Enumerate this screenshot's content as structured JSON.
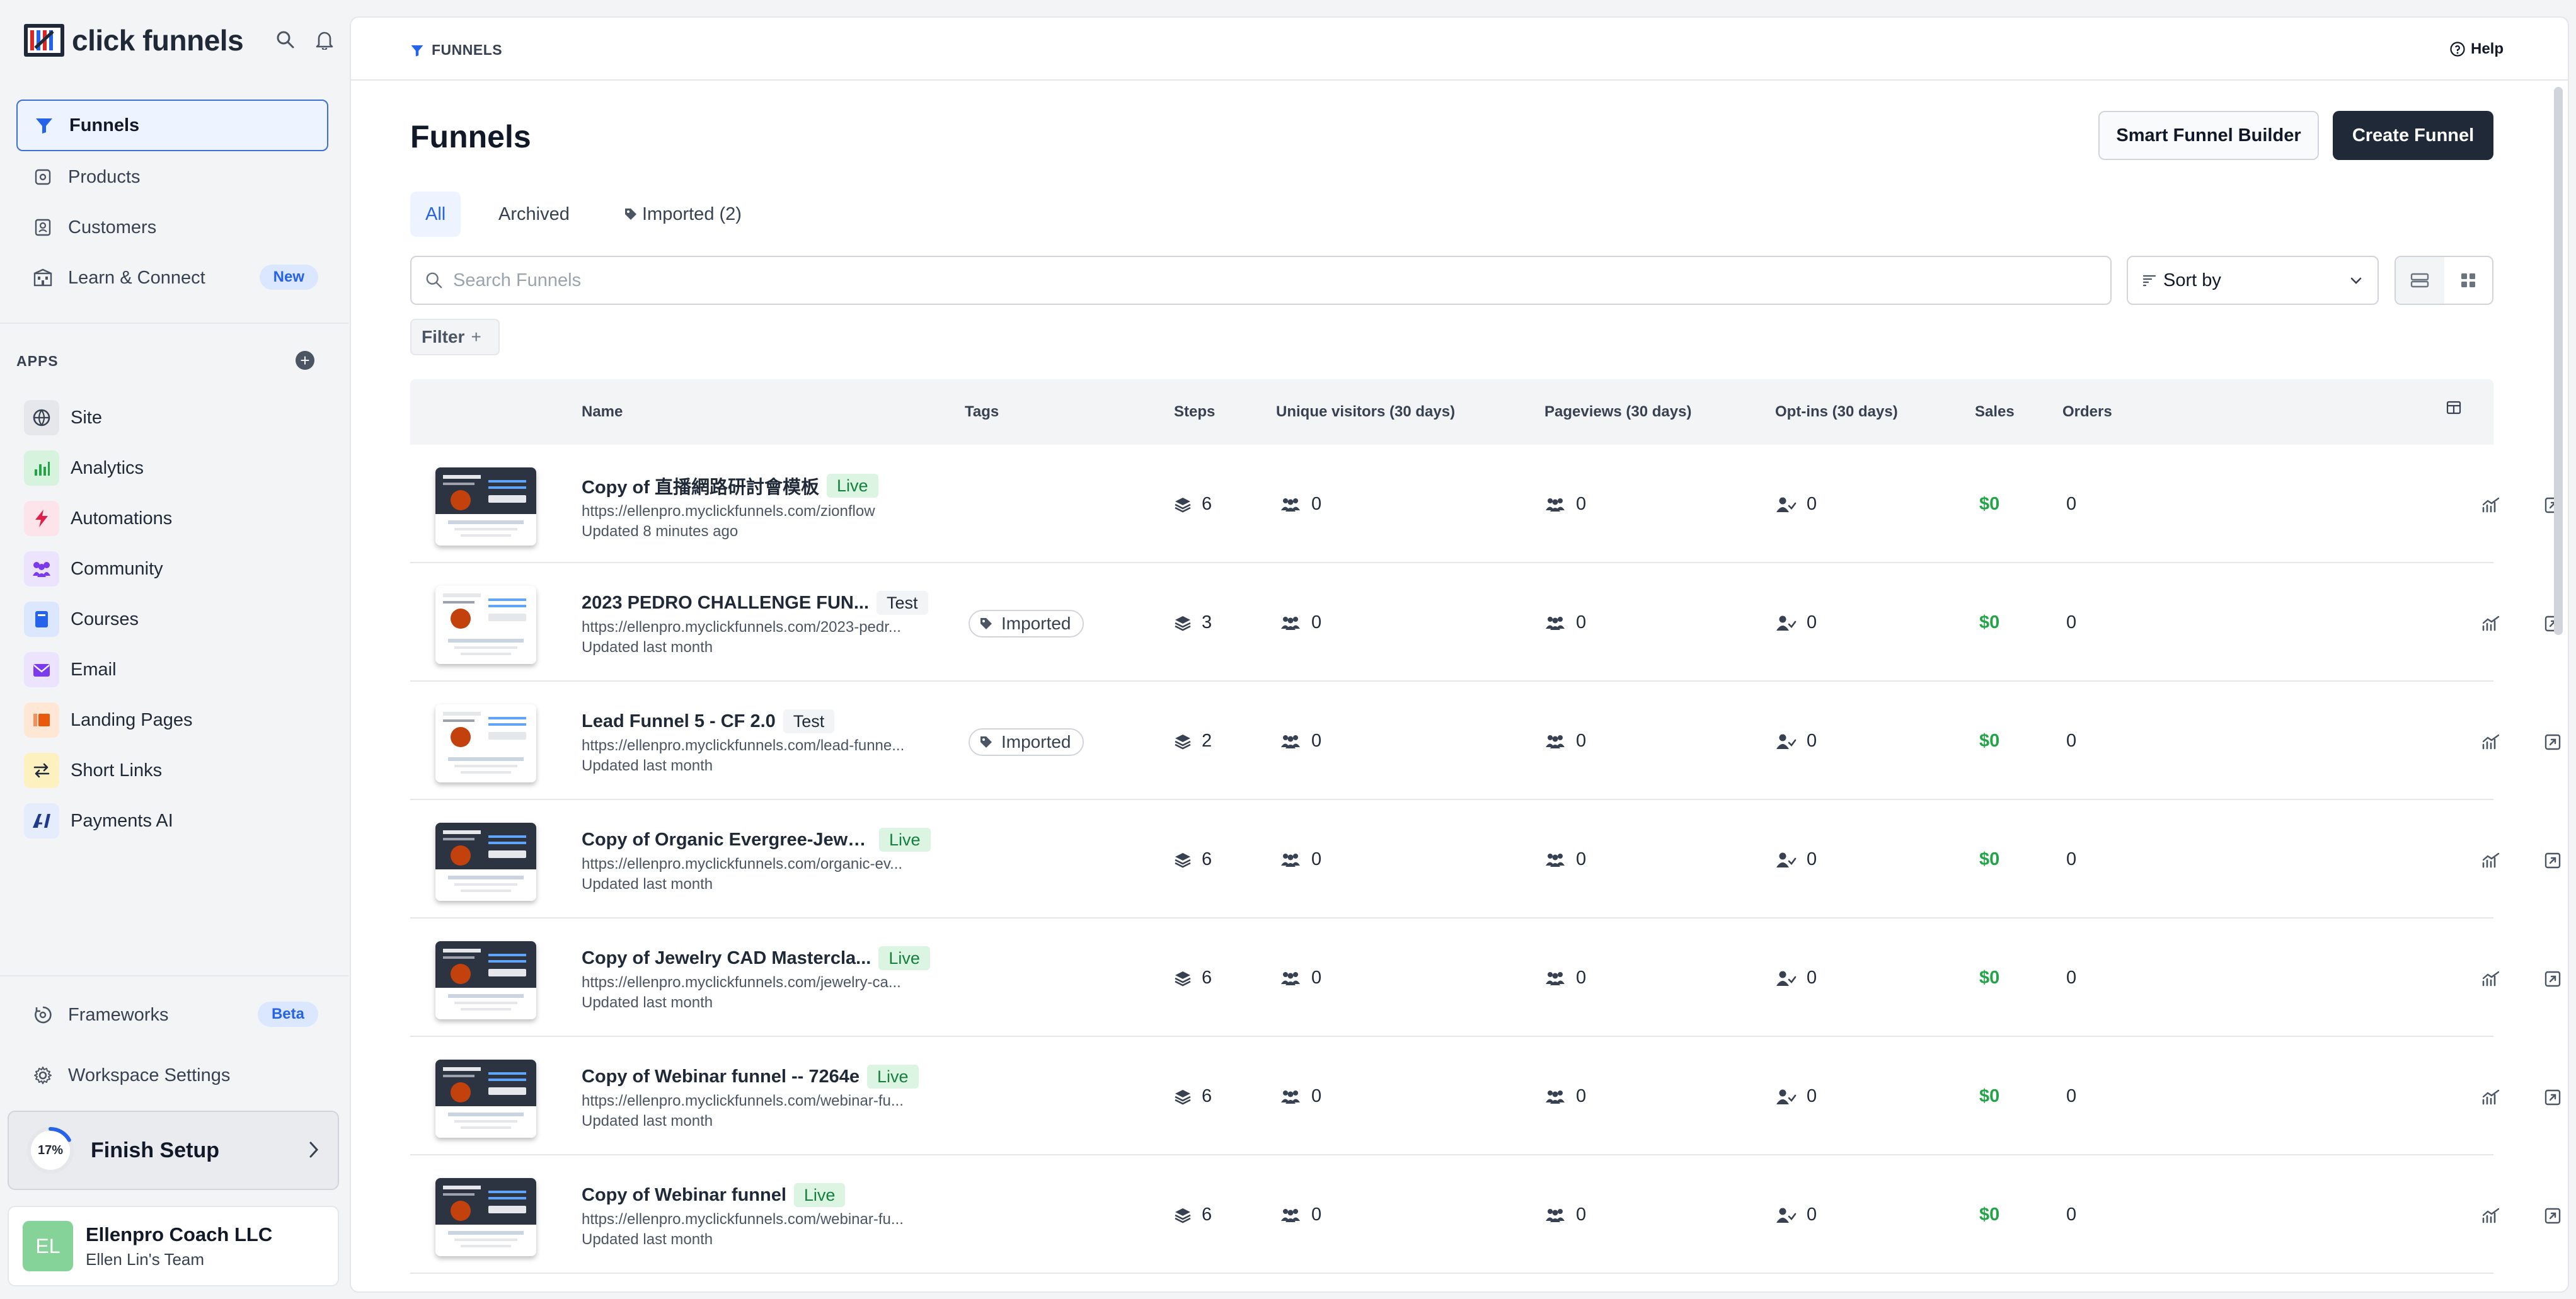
{
  "brand": {
    "name": "click funnels"
  },
  "sidebar": {
    "nav": [
      {
        "label": "Funnels",
        "icon": "funnel-icon",
        "active": true
      },
      {
        "label": "Products",
        "icon": "box-icon"
      },
      {
        "label": "Customers",
        "icon": "contact-icon"
      },
      {
        "label": "Learn & Connect",
        "icon": "building-icon",
        "badge": "New"
      }
    ],
    "apps_label": "APPS",
    "apps": [
      {
        "label": "Site",
        "icon": "globe-icon",
        "color": "#6b7280"
      },
      {
        "label": "Analytics",
        "icon": "bar-chart-icon",
        "color": "#22a447"
      },
      {
        "label": "Automations",
        "icon": "bolt-icon",
        "color": "#e11d48"
      },
      {
        "label": "Community",
        "icon": "people-icon",
        "color": "#7c3aed"
      },
      {
        "label": "Courses",
        "icon": "book-icon",
        "color": "#2563eb"
      },
      {
        "label": "Email",
        "icon": "mail-icon",
        "color": "#7c3aed"
      },
      {
        "label": "Landing Pages",
        "icon": "pages-icon",
        "color": "#ea580c"
      },
      {
        "label": "Short Links",
        "icon": "swap-icon",
        "color": "#ca8a04"
      },
      {
        "label": "Payments AI",
        "icon": "ai-icon",
        "color": "#1e3a8a"
      }
    ],
    "frameworks": {
      "label": "Frameworks",
      "badge": "Beta"
    },
    "workspace_settings": "Workspace Settings",
    "finish_setup": {
      "label": "Finish Setup",
      "progress_text": "17%",
      "progress": 0.17
    },
    "account": {
      "initials": "EL",
      "name": "Ellenpro Coach LLC",
      "team": "Ellen Lin's Team"
    }
  },
  "header": {
    "breadcrumb": "FUNNELS",
    "help": "Help"
  },
  "main": {
    "title": "Funnels",
    "smart_builder": "Smart Funnel Builder",
    "create": "Create Funnel",
    "tabs": [
      {
        "label": "All",
        "active": true
      },
      {
        "label": "Archived"
      },
      {
        "label": "Imported (2)",
        "icon": "tag-icon"
      }
    ],
    "search_placeholder": "Search Funnels",
    "sort_label": "Sort by",
    "filter_label": "Filter",
    "filter_plus": "+"
  },
  "table": {
    "columns": [
      "Name",
      "Tags",
      "Steps",
      "Unique visitors (30 days)",
      "Pageviews (30 days)",
      "Opt-ins (30 days)",
      "Sales",
      "Orders"
    ],
    "rows": [
      {
        "name": "Copy of 直播網路研討會模板",
        "status": "Live",
        "url": "https://ellenpro.myclickfunnels.com/zionflow",
        "updated": "Updated 8 minutes ago",
        "tag": "",
        "steps": "6",
        "visitors": "0",
        "pageviews": "0",
        "optins": "0",
        "sales": "$0",
        "orders": "0"
      },
      {
        "name": "2023 PEDRO CHALLENGE FUN...",
        "status": "Test",
        "url": "https://ellenpro.myclickfunnels.com/2023-pedr...",
        "updated": "Updated last month",
        "tag": "Imported",
        "steps": "3",
        "visitors": "0",
        "pageviews": "0",
        "optins": "0",
        "sales": "$0",
        "orders": "0"
      },
      {
        "name": "Lead Funnel 5 - CF 2.0",
        "status": "Test",
        "url": "https://ellenpro.myclickfunnels.com/lead-funne...",
        "updated": "Updated last month",
        "tag": "Imported",
        "steps": "2",
        "visitors": "0",
        "pageviews": "0",
        "optins": "0",
        "sales": "$0",
        "orders": "0"
      },
      {
        "name": "Copy of Organic Evergree-Jewe...",
        "status": "Live",
        "url": "https://ellenpro.myclickfunnels.com/organic-ev...",
        "updated": "Updated last month",
        "tag": "",
        "steps": "6",
        "visitors": "0",
        "pageviews": "0",
        "optins": "0",
        "sales": "$0",
        "orders": "0"
      },
      {
        "name": "Copy of Jewelry CAD Mastercla...",
        "status": "Live",
        "url": "https://ellenpro.myclickfunnels.com/jewelry-ca...",
        "updated": "Updated last month",
        "tag": "",
        "steps": "6",
        "visitors": "0",
        "pageviews": "0",
        "optins": "0",
        "sales": "$0",
        "orders": "0"
      },
      {
        "name": "Copy of Webinar funnel -- 7264e",
        "status": "Live",
        "url": "https://ellenpro.myclickfunnels.com/webinar-fu...",
        "updated": "Updated last month",
        "tag": "",
        "steps": "6",
        "visitors": "0",
        "pageviews": "0",
        "optins": "0",
        "sales": "$0",
        "orders": "0"
      },
      {
        "name": "Copy of Webinar funnel",
        "status": "Live",
        "url": "https://ellenpro.myclickfunnels.com/webinar-fu...",
        "updated": "Updated last month",
        "tag": "",
        "steps": "6",
        "visitors": "0",
        "pageviews": "0",
        "optins": "0",
        "sales": "$0",
        "orders": "0"
      }
    ]
  },
  "colors": {
    "accent": "#2563eb",
    "primary_button": "#1f2937",
    "sales": "#22a447",
    "live_bg": "#dcf5e3"
  }
}
